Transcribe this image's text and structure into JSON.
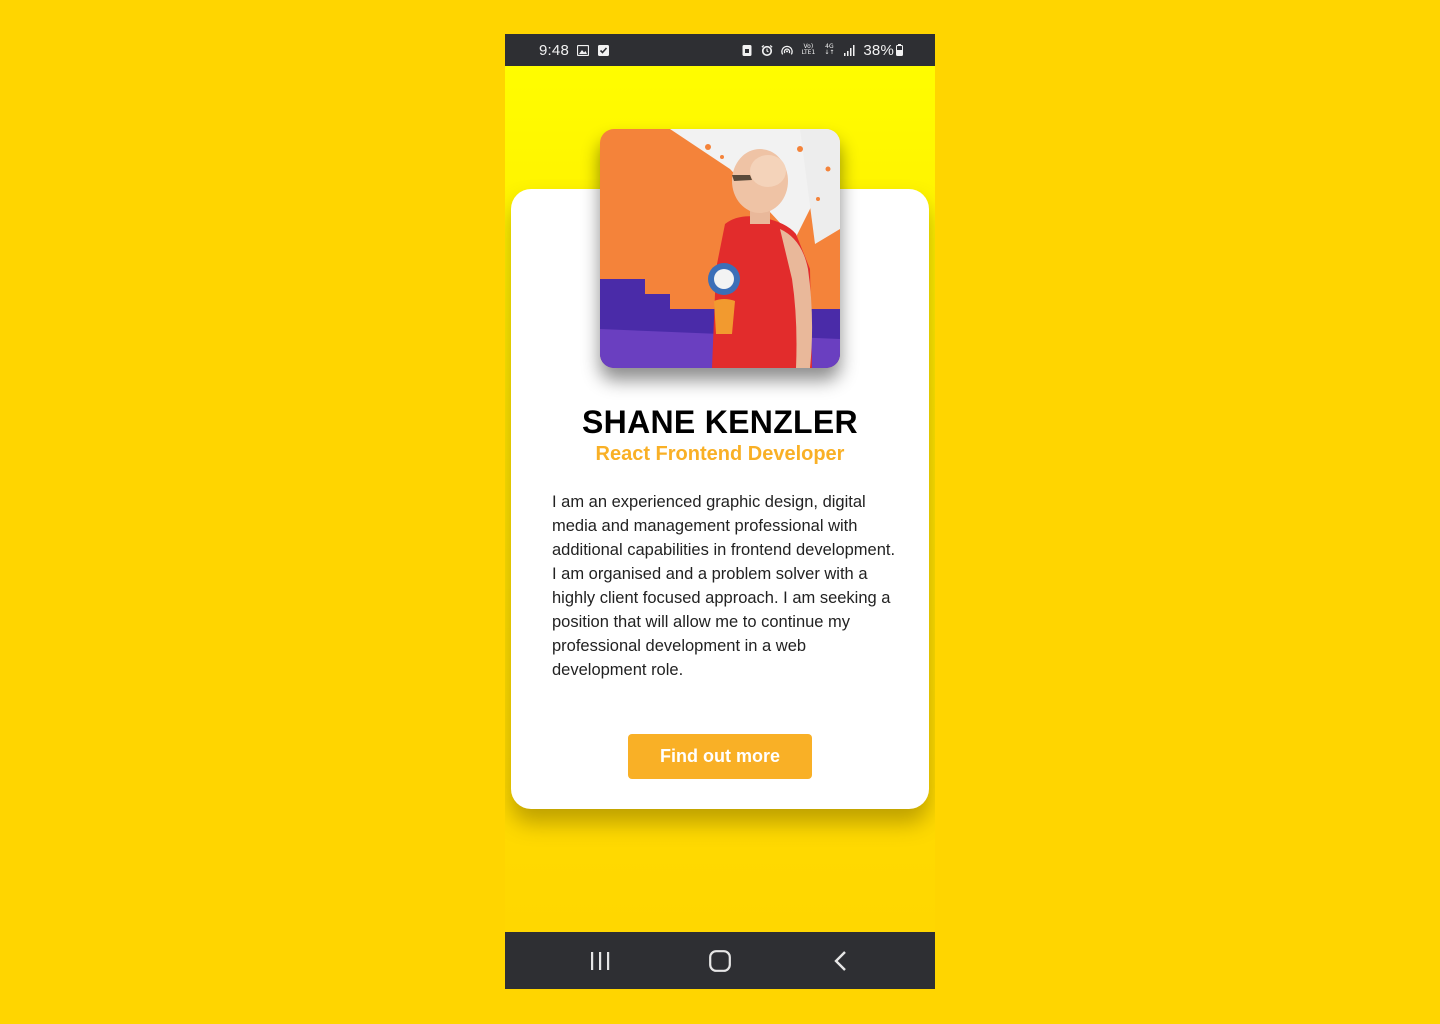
{
  "status_bar": {
    "time": "9:48",
    "network_top": "Vo)",
    "network_bottom": "LTE1",
    "signal_type": "4G",
    "battery_percent": "38%",
    "icons": [
      "image-icon",
      "check-icon",
      "lock-icon",
      "alarm-icon",
      "hotspot-icon",
      "volte-icon",
      "data-arrows-icon",
      "signal-icon",
      "battery-icon"
    ]
  },
  "profile": {
    "name": "SHANE KENZLER",
    "role": "React Frontend Developer",
    "bio": "I am an experienced graphic design, digital media and management professional with additional capabilities in frontend development. I am organised and a problem solver with a highly client focused approach. I am seeking a position that will allow me to continue my professional development in a web development role.",
    "cta_label": "Find out more"
  },
  "nav_bar": {
    "icons": [
      "recent-apps-icon",
      "home-icon",
      "back-icon"
    ]
  },
  "colors": {
    "page_background": "#FFD500",
    "accent": "#F9B026",
    "system_bar": "#2e2f33",
    "card": "#ffffff"
  }
}
